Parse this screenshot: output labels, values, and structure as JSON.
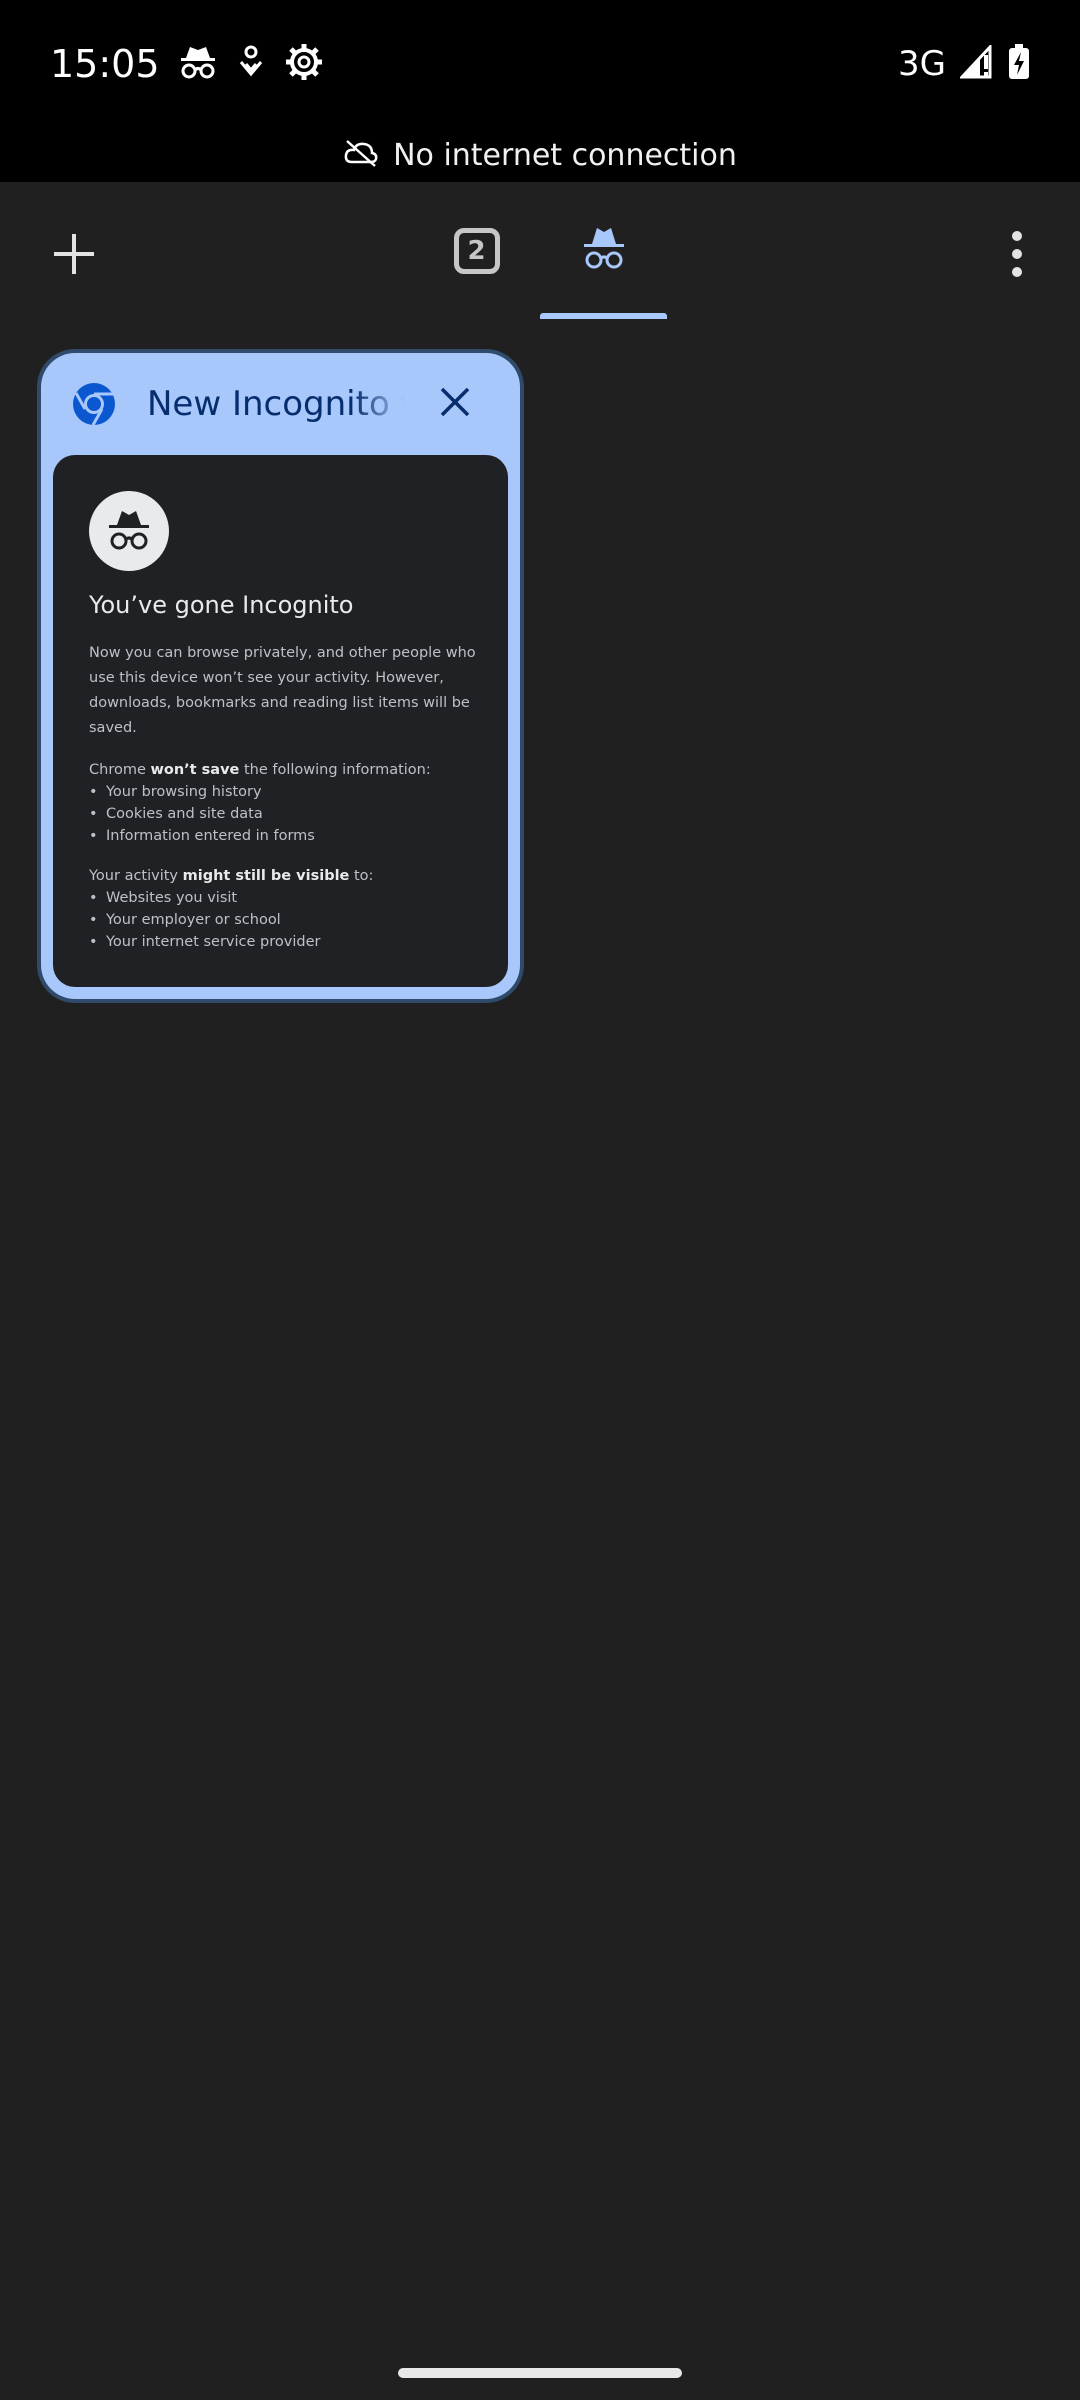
{
  "status_bar": {
    "time": "15:05",
    "network": "3G",
    "icons": [
      "incognito-icon",
      "location-icon",
      "settings-icon",
      "signal-icon",
      "battery-charging-icon"
    ]
  },
  "offline_banner": {
    "text": "No internet connection",
    "icon": "cloud-off-icon"
  },
  "toolbar": {
    "add_icon": "plus-icon",
    "normal_tab_count": "2",
    "incognito_icon": "incognito-icon",
    "menu_icon": "more-vert-icon"
  },
  "tab_card": {
    "title": "New Incognito tab",
    "favicon": "chrome-icon",
    "close_icon": "close-icon"
  },
  "incognito_page": {
    "heading": "You’ve gone Incognito",
    "intro": "Now you can browse privately, and other people who use this device won’t see your activity. However, downloads, bookmarks and reading list items will be saved.",
    "wont_save_prefix": "Chrome ",
    "wont_save_bold": "won’t save",
    "wont_save_suffix": " the following information:",
    "wont_save_items": [
      "Your browsing history",
      "Cookies and site data",
      "Information entered in forms"
    ],
    "visible_prefix": "Your activity ",
    "visible_bold": "might still be visible",
    "visible_suffix": " to:",
    "visible_items": [
      "Websites you visit",
      "Your employer or school",
      "Your internet service provider"
    ]
  },
  "colors": {
    "accent": "#a8c7fa",
    "tab_title": "#062e6f",
    "background": "#202020"
  }
}
